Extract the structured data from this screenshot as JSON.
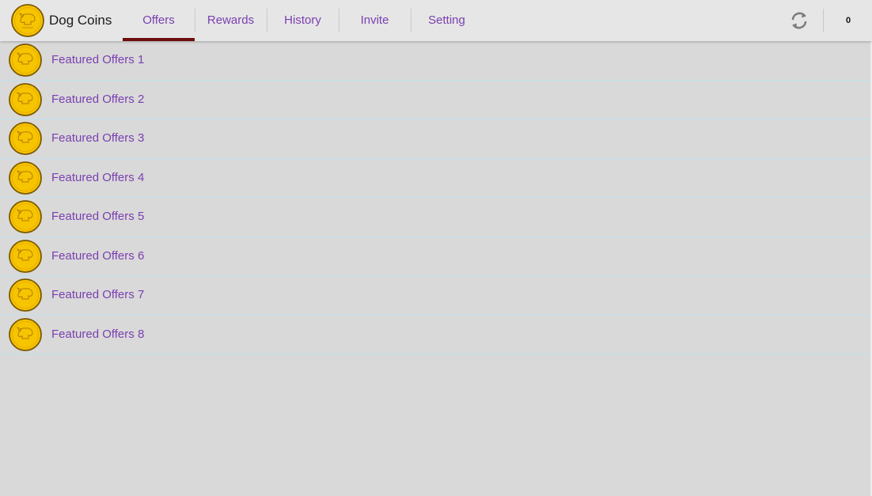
{
  "app": {
    "title": "Dog Coins",
    "logo_icon": "dog-coin-icon"
  },
  "tabs": [
    {
      "label": "Offers",
      "active": true
    },
    {
      "label": "Rewards",
      "active": false
    },
    {
      "label": "History",
      "active": false
    },
    {
      "label": "Invite",
      "active": false
    },
    {
      "label": "Setting",
      "active": false
    }
  ],
  "toolbar": {
    "refresh_icon": "refresh-icon",
    "coin_count": "0"
  },
  "offers": [
    {
      "label": "Featured Offers 1"
    },
    {
      "label": "Featured Offers 2"
    },
    {
      "label": "Featured Offers 3"
    },
    {
      "label": "Featured Offers 4"
    },
    {
      "label": "Featured Offers 5"
    },
    {
      "label": "Featured Offers 6"
    },
    {
      "label": "Featured Offers 7"
    },
    {
      "label": "Featured Offers 8"
    }
  ],
  "colors": {
    "accent_text": "#7a3fb0",
    "tab_indicator": "#6b0f0f",
    "coin_fill": "#f7c400",
    "coin_rim": "#8a6a00",
    "list_divider": "#bfe0ee",
    "background": "#d9d9d9"
  }
}
